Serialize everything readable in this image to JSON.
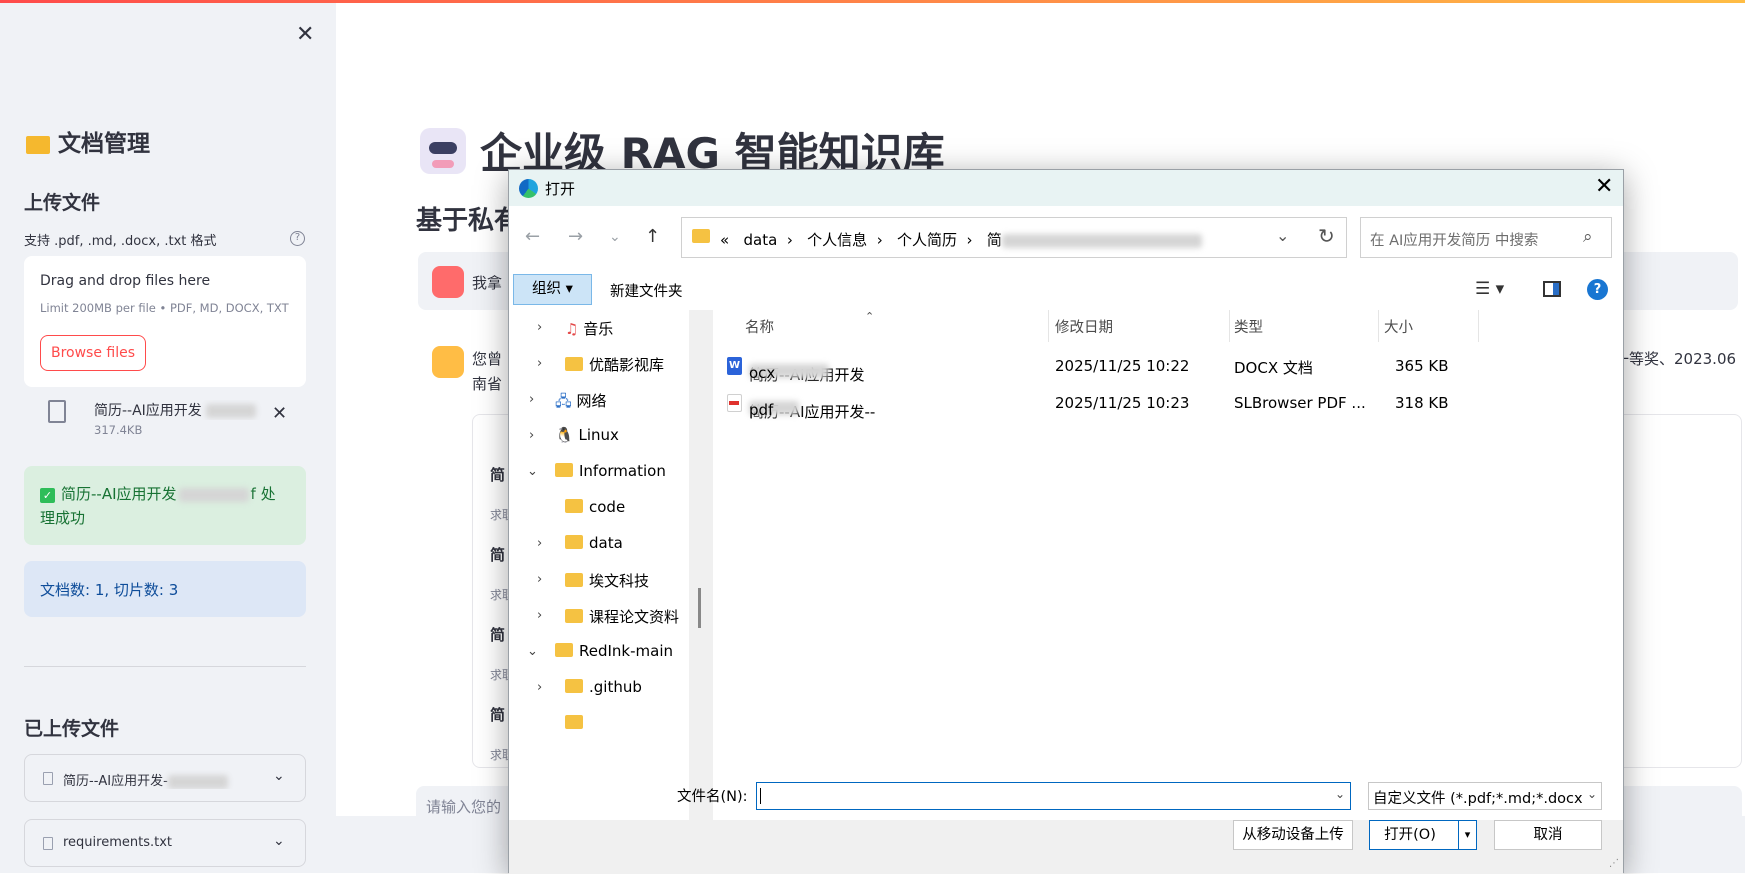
{
  "sidebar": {
    "title": "文档管理",
    "upload_heading": "上传文件",
    "formats": "支持 .pdf, .md, .docx, .txt 格式",
    "dropzone_title": "Drag and drop files here",
    "dropzone_limit": "Limit 200MB per file • PDF, MD, DOCX, TXT",
    "browse_label": "Browse files",
    "uploaded_file_name": "简历--AI应用开发",
    "uploaded_file_size": "317.4KB",
    "success_prefix": "简历--AI应用开发",
    "success_suffix": "f 处理成功",
    "info_text": "文档数: 1, 切片数: 3",
    "uploaded_heading": "已上传文件",
    "uploaded_files": [
      "简历--AI应用开发-",
      "requirements.txt"
    ]
  },
  "main": {
    "title": "企业级 RAG 智能知识库",
    "subtitle": "基于私有",
    "user_msg": "我拿",
    "reply_start": "您曾",
    "reply_line2": "南省",
    "reply_tail": "一等奖、2023.06",
    "sources": [
      "简",
      "简",
      "简",
      "简"
    ],
    "source_sub": "求职",
    "input_placeholder": "请输入您的"
  },
  "dialog": {
    "title": "打开",
    "path": [
      "data",
      "个人信息",
      "个人简历",
      "简"
    ],
    "path_prefix": "«",
    "search_placeholder": "在 AI应用开发简历 中搜索",
    "organize": "组织 ▾",
    "new_folder": "新建文件夹",
    "tree": [
      {
        "label": "音乐",
        "expanded": false
      },
      {
        "label": "优酷影视库",
        "expanded": false
      },
      {
        "label": "网络",
        "expanded": false
      },
      {
        "label": "Linux",
        "expanded": false
      },
      {
        "label": "Information",
        "expanded": true
      },
      {
        "label": "code",
        "expanded": false
      },
      {
        "label": "data",
        "expanded": false
      },
      {
        "label": "埃文科技",
        "expanded": false
      },
      {
        "label": "课程论文资料",
        "expanded": false
      },
      {
        "label": "RedInk-main",
        "expanded": true
      },
      {
        "label": ".github",
        "expanded": false
      }
    ],
    "columns": {
      "name": "名称",
      "date": "修改日期",
      "type": "类型",
      "size": "大小"
    },
    "files": [
      {
        "name_start": "简历--AI应用开发",
        "name_end": "ocx",
        "date": "2025/11/25 10:22",
        "type": "DOCX 文档",
        "size": "365 KB"
      },
      {
        "name_start": "简历--AI应用开发--",
        "name_end": "pdf",
        "date": "2025/11/25 10:23",
        "type": "SLBrowser PDF ...",
        "size": "318 KB"
      }
    ],
    "filename_label": "文件名(N):",
    "filetype": "自定义文件 (*.pdf;*.md;*.docx",
    "upload_mobile": "从移动设备上传",
    "open_label": "打开(O)",
    "cancel_label": "取消",
    "colors": {
      "accent": "#0067c0",
      "folder": "#f5c242"
    }
  }
}
